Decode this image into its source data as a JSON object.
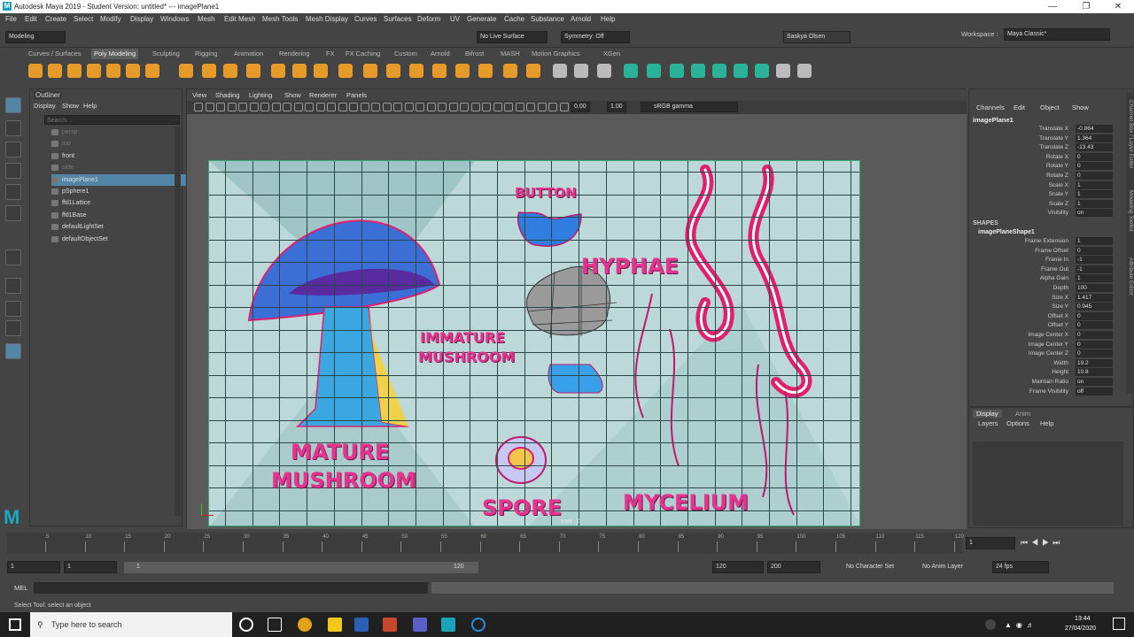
{
  "window": {
    "title": "Autodesk Maya 2019 - Student Version: untitled*   ---   imagePlane1",
    "logo": "M"
  },
  "menubar": [
    "File",
    "Edit",
    "Create",
    "Select",
    "Modify",
    "Display",
    "Windows",
    "Mesh",
    "Edit Mesh",
    "Mesh Tools",
    "Mesh Display",
    "Curves",
    "Surfaces",
    "Deform",
    "UV",
    "Generate",
    "Cache",
    "Substance",
    "Arnold",
    "Help"
  ],
  "workspace": {
    "label": "Workspace :",
    "value": "Maya Classic*"
  },
  "statusline": {
    "mode": "Modeling",
    "live_surface": "No Live Surface",
    "symmetry": "Symmetry: Off",
    "user": "Saskya Olsen"
  },
  "shelf_tabs": [
    "Curves / Surfaces",
    "Poly Modeling",
    "Sculpting",
    "Rigging",
    "Animation",
    "Rendering",
    "FX",
    "FX Caching",
    "Custom",
    "Arnold",
    "Bifrost",
    "MASH",
    "Motion Graphics",
    "XGen"
  ],
  "shelf_active": "Poly Modeling",
  "outliner": {
    "title": "Outliner",
    "menu": [
      "Display",
      "Show",
      "Help"
    ],
    "search_placeholder": "Search...",
    "items": [
      {
        "label": "persp",
        "dim": true
      },
      {
        "label": "top",
        "dim": true
      },
      {
        "label": "front",
        "dim": false
      },
      {
        "label": "side",
        "dim": true
      },
      {
        "label": "imagePlane1",
        "dim": false,
        "selected": true
      },
      {
        "label": "pSphere1",
        "dim": false
      },
      {
        "label": "ffd1Lattice",
        "dim": false
      },
      {
        "label": "ffd1Base",
        "dim": false
      },
      {
        "label": "defaultLightSet",
        "dim": false
      },
      {
        "label": "defaultObjectSet",
        "dim": false
      }
    ]
  },
  "viewport": {
    "menu": [
      "View",
      "Shading",
      "Lighting",
      "Show",
      "Renderer",
      "Panels"
    ],
    "exposure": "0.00",
    "gamma": "1.00",
    "color_space": "sRGB gamma",
    "camera_label": "front -Z",
    "labels": {
      "button": "BUTTON",
      "hyphae": "HYPHAE",
      "immature1": "IMMATURE",
      "immature2": "MUSHROOM",
      "mature1": "MATURE",
      "mature2": "MUSHROOM",
      "spore": "SPORE",
      "mycelium": "MYCELIUM"
    }
  },
  "channels": {
    "menu": [
      "Channels",
      "Edit",
      "Object",
      "Show"
    ],
    "object": "imagePlane1",
    "attrs": [
      {
        "name": "Translate X",
        "value": "-0.864"
      },
      {
        "name": "Translate Y",
        "value": "1.364"
      },
      {
        "name": "Translate Z",
        "value": "-13.43"
      },
      {
        "name": "Rotate X",
        "value": "0"
      },
      {
        "name": "Rotate Y",
        "value": "0"
      },
      {
        "name": "Rotate Z",
        "value": "0"
      },
      {
        "name": "Scale X",
        "value": "1"
      },
      {
        "name": "Scale Y",
        "value": "1"
      },
      {
        "name": "Scale Z",
        "value": "1"
      },
      {
        "name": "Visibility",
        "value": "on"
      }
    ],
    "shapes_header": "SHAPES",
    "shape_name": "imagePlaneShape1",
    "shape_attrs": [
      {
        "name": "Frame Extension",
        "value": "1"
      },
      {
        "name": "Frame Offset",
        "value": "0"
      },
      {
        "name": "Frame In",
        "value": "-1"
      },
      {
        "name": "Frame Out",
        "value": "-1"
      },
      {
        "name": "Alpha Gain",
        "value": "1"
      },
      {
        "name": "Depth",
        "value": "100"
      },
      {
        "name": "Size X",
        "value": "1.417"
      },
      {
        "name": "Size Y",
        "value": "0.945"
      },
      {
        "name": "Offset X",
        "value": "0"
      },
      {
        "name": "Offset Y",
        "value": "0"
      },
      {
        "name": "Image Center X",
        "value": "0"
      },
      {
        "name": "Image Center Y",
        "value": "0"
      },
      {
        "name": "Image Center Z",
        "value": "0"
      },
      {
        "name": "Width",
        "value": "19.2"
      },
      {
        "name": "Height",
        "value": "10.8"
      },
      {
        "name": "Maintain Ratio",
        "value": "on"
      },
      {
        "name": "Frame Visibility",
        "value": "off"
      }
    ],
    "side_tabs": [
      "Channel Box / Layer Editor",
      "Modeling Toolkit",
      "Attribute Editor"
    ]
  },
  "layers": {
    "tabs": [
      "Display",
      "Anim"
    ],
    "menu": [
      "Layers",
      "Options",
      "Help"
    ]
  },
  "timeline": {
    "ticks": [
      "5",
      "10",
      "15",
      "20",
      "25",
      "30",
      "35",
      "40",
      "45",
      "50",
      "55",
      "60",
      "65",
      "70",
      "75",
      "80",
      "85",
      "90",
      "95",
      "100",
      "105",
      "110",
      "115",
      "120"
    ],
    "current_frame": "1"
  },
  "range": {
    "start": "1",
    "start2": "1",
    "slider_start": "1",
    "slider_end": "120",
    "end": "120",
    "end2": "200",
    "character": "No Character Set",
    "anim_layer": "No Anim Layer",
    "fps": "24 fps"
  },
  "cmdline": {
    "label": "MEL"
  },
  "helpline": {
    "text": "Select Tool: select an object"
  },
  "taskbar": {
    "search": "Type here to search",
    "time": "13:44",
    "date": "27/04/2020"
  }
}
